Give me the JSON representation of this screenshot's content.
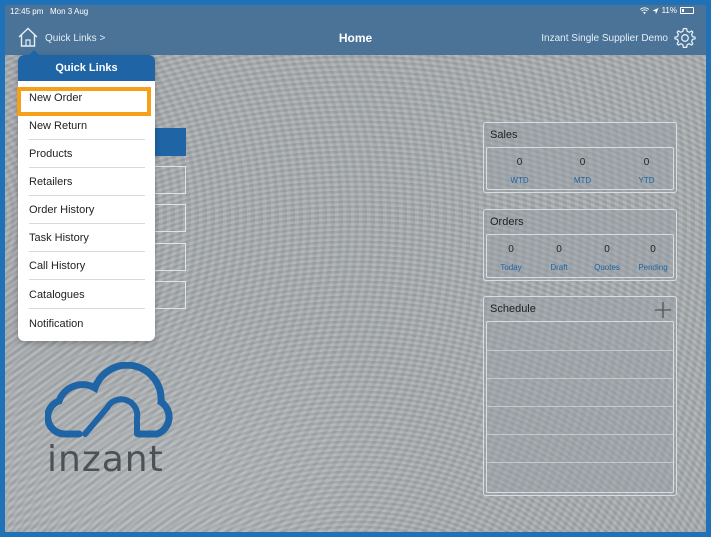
{
  "status_bar": {
    "time": "12:45 pm",
    "date": "Mon 3 Aug",
    "battery": "11%"
  },
  "nav": {
    "quick_links_label": "Quick Links >",
    "title": "Home",
    "org_name": "Inzant Single Supplier Demo"
  },
  "dropdown": {
    "header": "Quick Links",
    "items": [
      {
        "label": "New Order"
      },
      {
        "label": "New Return"
      },
      {
        "label": "Products"
      },
      {
        "label": "Retailers"
      },
      {
        "label": "Order History"
      },
      {
        "label": "Task History"
      },
      {
        "label": "Call History"
      },
      {
        "label": "Catalogues"
      },
      {
        "label": "Notification"
      }
    ]
  },
  "logo": {
    "text": "inzant"
  },
  "sales": {
    "title": "Sales",
    "stats": [
      {
        "value": "0",
        "label": "WTD"
      },
      {
        "value": "0",
        "label": "MTD"
      },
      {
        "value": "0",
        "label": "YTD"
      }
    ]
  },
  "orders": {
    "title": "Orders",
    "stats": [
      {
        "value": "0",
        "label": "Today"
      },
      {
        "value": "0",
        "label": "Draft"
      },
      {
        "value": "0",
        "label": "Quotes"
      },
      {
        "value": "0",
        "label": "Pending"
      }
    ]
  },
  "schedule": {
    "title": "Schedule"
  },
  "colors": {
    "nav_bar": "#4a7397",
    "accent_blue": "#1f64a4",
    "highlight": "#f6a01a",
    "frame": "#1f72b8"
  },
  "icons": {
    "home": "home-icon",
    "settings": "gear-icon",
    "add": "plus-icon",
    "wifi": "wifi-icon",
    "location": "location-icon",
    "battery": "battery-icon"
  }
}
